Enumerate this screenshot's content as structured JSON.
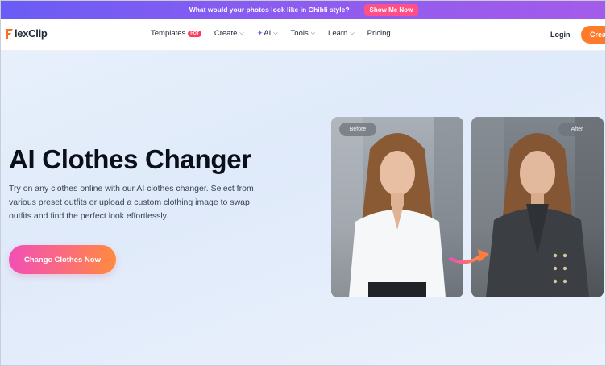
{
  "promo": {
    "text": "What would your photos look like in Ghibli style?",
    "button": "Show Me Now"
  },
  "nav": {
    "logo": "lexClip",
    "items": [
      {
        "label": "Templates",
        "badge": "HOT"
      },
      {
        "label": "Create"
      },
      {
        "label": "AI"
      },
      {
        "label": "Tools"
      },
      {
        "label": "Learn"
      },
      {
        "label": "Pricing"
      }
    ],
    "login": "Login",
    "create": "Creat"
  },
  "hero": {
    "title": "AI Clothes Changer",
    "description": "Try on any clothes online with our AI clothes changer. Select from various preset outfits or upload a custom clothing image to swap outfits and find the perfect look effortlessly.",
    "cta": "Change Clothes Now"
  },
  "images": {
    "before_label": "Before",
    "after_label": "After"
  },
  "colors": {
    "promo_bg": "#7b5cf3",
    "promo_button": "#ff4f86",
    "create_button": "#ff7a2b",
    "hot_badge": "#ff3b5c",
    "cta_start": "#f24fb5",
    "cta_end": "#ff8a3d"
  }
}
